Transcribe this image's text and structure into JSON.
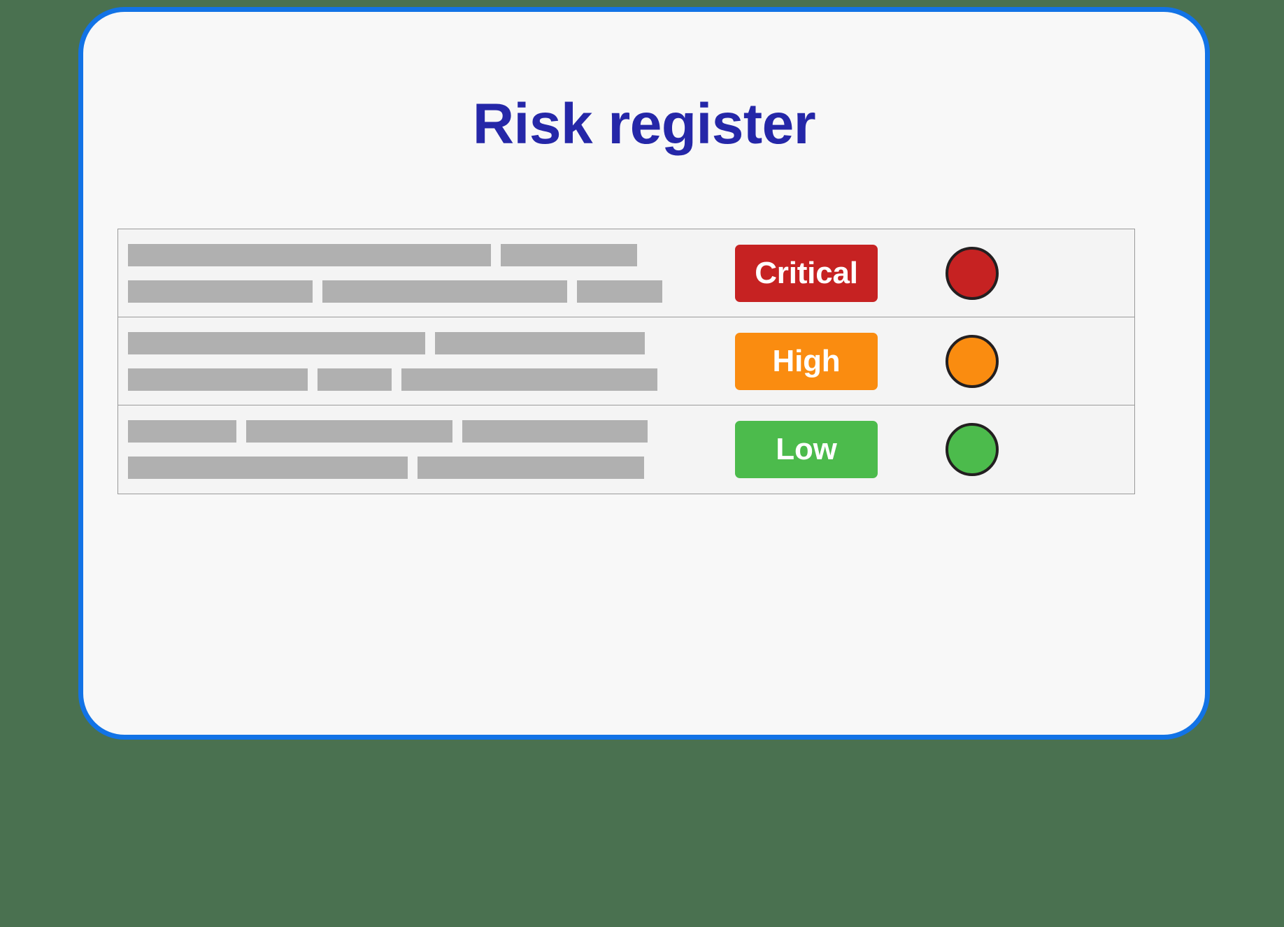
{
  "page": {
    "background_color": "#4a7150",
    "card_background": "#f8f8f8",
    "card_border_color": "#1273e6"
  },
  "header": {
    "title": "Risk register",
    "title_color": "#2527a8"
  },
  "table": {
    "border_color": "#9a9a9a",
    "row_background": "#f4f4f4",
    "skeleton_color": "#b0b0b0",
    "dot_border_color": "#231f20",
    "rows": [
      {
        "severity_label": "Critical",
        "badge_color": "#c62222",
        "dot_color": "#c62222",
        "skeleton_lines": [
          [
            519,
            195
          ],
          [
            264,
            350,
            122
          ]
        ]
      },
      {
        "severity_label": "High",
        "badge_color": "#fa8c10",
        "dot_color": "#fa8c10",
        "skeleton_lines": [
          [
            425,
            300
          ],
          [
            257,
            106,
            366
          ]
        ]
      },
      {
        "severity_label": "Low",
        "badge_color": "#4cbb4c",
        "dot_color": "#4cbb4c",
        "skeleton_lines": [
          [
            155,
            295,
            265
          ],
          [
            400,
            324
          ]
        ]
      }
    ]
  }
}
